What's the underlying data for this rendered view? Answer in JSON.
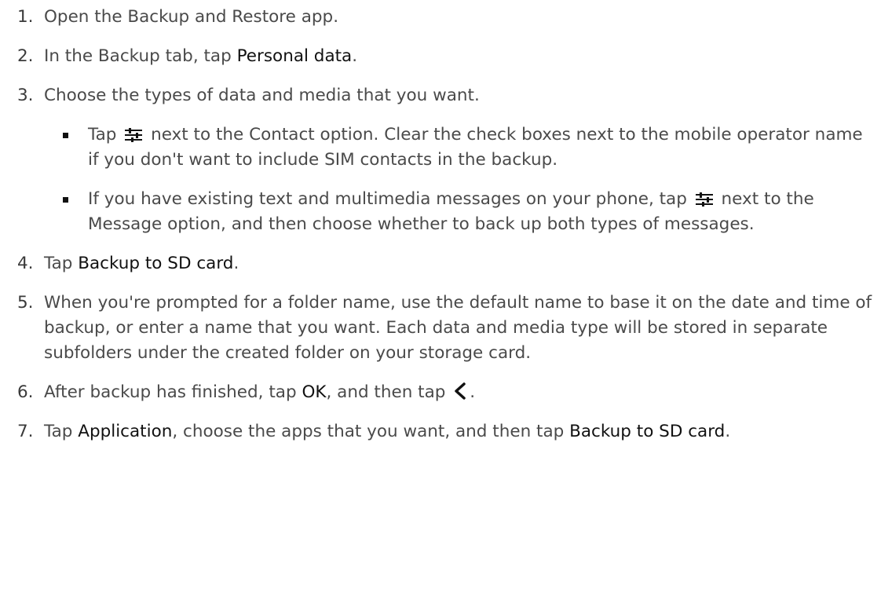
{
  "steps": [
    {
      "num": "1.",
      "t1": "Open the Backup and Restore app."
    },
    {
      "num": "2.",
      "t1": "In the Backup tab, tap ",
      "b1": "Personal data",
      "t2": "."
    },
    {
      "num": "3.",
      "t1": "Choose the types of data and media that you want.",
      "sub": [
        {
          "t1": "Tap ",
          "icon": "settings-sliders-icon",
          "t2": " next to the Contact option. Clear the check boxes next to the mobile operator name if you don't want to include SIM contacts in the backup."
        },
        {
          "t1": "If you have existing text and multimedia messages on your phone, tap ",
          "icon": "settings-sliders-icon",
          "t2": " next to the Message option, and then choose whether to back up both types of messages."
        }
      ]
    },
    {
      "num": "4.",
      "t1": "Tap ",
      "b1": "Backup to SD card",
      "t2": "."
    },
    {
      "num": "5.",
      "t1": "When you're prompted for a folder name, use the default name to base it on the date and time of backup, or enter a name that you want. Each data and media type will be stored in separate subfolders under the created folder on your storage card."
    },
    {
      "num": "6.",
      "t1": "After backup has finished, tap ",
      "b1": "OK",
      "t2": ", and then tap ",
      "icon": "back-chevron-icon",
      "t3": "."
    },
    {
      "num": "7.",
      "t1": "Tap ",
      "b1": "Application",
      "t2": ", choose the apps that you want, and then tap ",
      "b2": "Backup to SD card",
      "t3": "."
    }
  ]
}
